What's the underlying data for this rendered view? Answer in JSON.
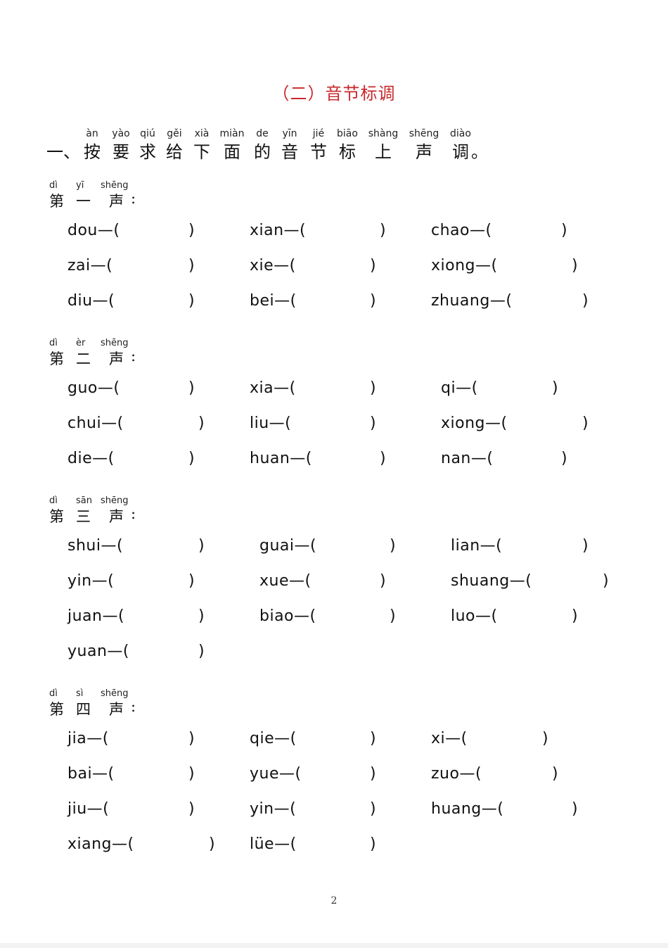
{
  "page": {
    "title": "（二）音节标调",
    "page_number": "2"
  },
  "question": {
    "prefix": "一、",
    "chars": [
      {
        "pinyin": "àn",
        "han": "按"
      },
      {
        "pinyin": "yào",
        "han": "要"
      },
      {
        "pinyin": "qiú",
        "han": "求"
      },
      {
        "pinyin": "gěi",
        "han": "给"
      },
      {
        "pinyin": "xià",
        "han": "下"
      },
      {
        "pinyin": "miàn",
        "han": "面"
      },
      {
        "pinyin": "de",
        "han": "的"
      },
      {
        "pinyin": "yīn",
        "han": "音"
      },
      {
        "pinyin": "jié",
        "han": "节"
      },
      {
        "pinyin": "biāo",
        "han": "标"
      },
      {
        "pinyin": "shàng",
        "han": "上"
      },
      {
        "pinyin": "shēng",
        "han": "声"
      },
      {
        "pinyin": "diào",
        "han": "调"
      }
    ],
    "suffix": "。"
  },
  "sections": [
    {
      "heading": {
        "pinyin": [
          "dì",
          "yī",
          "shēng"
        ],
        "han": [
          "第",
          "一",
          "声"
        ],
        "colon": ":"
      },
      "rows": [
        [
          "dou—(",
          "xian—(",
          "chao—("
        ],
        [
          "zai—(",
          "xie—(",
          "xiong—("
        ],
        [
          "diu—(",
          "bei—(",
          "zhuang—("
        ]
      ]
    },
    {
      "heading": {
        "pinyin": [
          "dì",
          "èr",
          "shēng"
        ],
        "han": [
          "第",
          "二",
          "声"
        ],
        "colon": ":"
      },
      "rows": [
        [
          "guo—(",
          "xia—(",
          "qi—("
        ],
        [
          "chui—(",
          "liu—(",
          "xiong—("
        ],
        [
          "die—(",
          "huan—(",
          "nan—("
        ]
      ]
    },
    {
      "heading": {
        "pinyin": [
          "dì",
          "sān",
          "shēng"
        ],
        "han": [
          "第",
          "三",
          "声"
        ],
        "colon": ":"
      },
      "rows": [
        [
          "shui—(",
          "guai—(",
          "lian—("
        ],
        [
          "yin—(",
          "xue—(",
          "shuang—("
        ],
        [
          "juan—(",
          "biao—(",
          "luo—("
        ],
        [
          "yuan—("
        ]
      ]
    },
    {
      "heading": {
        "pinyin": [
          "dì",
          "sì",
          "shēng"
        ],
        "han": [
          "第",
          "四",
          "声"
        ],
        "colon": ":"
      },
      "rows": [
        [
          "jia—(",
          "qie—(",
          "xi—("
        ],
        [
          "bai—(",
          "yue—(",
          "zuo—("
        ],
        [
          "jiu—(",
          "yin—(",
          "huang—("
        ],
        [
          "xiang—(",
          "lüe—("
        ]
      ]
    }
  ],
  "symbols": {
    "close_paren": ")"
  }
}
